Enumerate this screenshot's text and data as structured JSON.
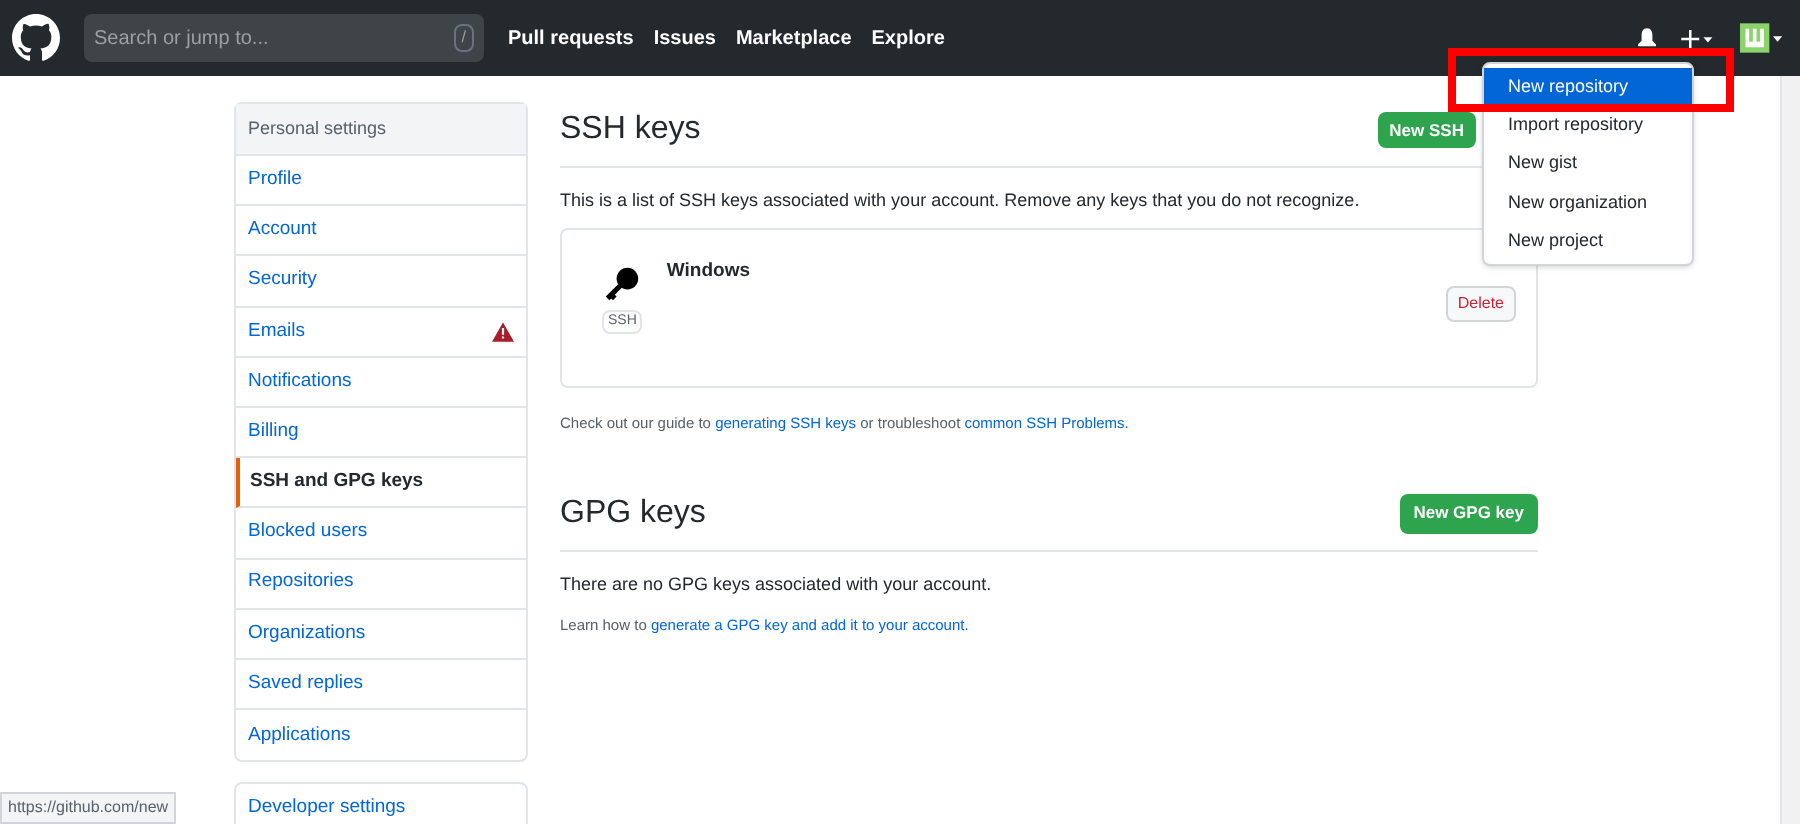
{
  "header": {
    "search_placeholder": "Search or jump to...",
    "search_key": "/",
    "nav": [
      "Pull requests",
      "Issues",
      "Marketplace",
      "Explore"
    ]
  },
  "sidebar": {
    "title": "Personal settings",
    "items": [
      {
        "label": "Profile",
        "selected": false,
        "warning": false
      },
      {
        "label": "Account",
        "selected": false,
        "warning": false
      },
      {
        "label": "Security",
        "selected": false,
        "warning": false
      },
      {
        "label": "Emails",
        "selected": false,
        "warning": true
      },
      {
        "label": "Notifications",
        "selected": false,
        "warning": false
      },
      {
        "label": "Billing",
        "selected": false,
        "warning": false
      },
      {
        "label": "SSH and GPG keys",
        "selected": true,
        "warning": false
      },
      {
        "label": "Blocked users",
        "selected": false,
        "warning": false
      },
      {
        "label": "Repositories",
        "selected": false,
        "warning": false
      },
      {
        "label": "Organizations",
        "selected": false,
        "warning": false
      },
      {
        "label": "Saved replies",
        "selected": false,
        "warning": false
      },
      {
        "label": "Applications",
        "selected": false,
        "warning": false
      }
    ],
    "developer": "Developer settings"
  },
  "ssh": {
    "title": "SSH keys",
    "button": "New SSH",
    "description": "This is a list of SSH keys associated with your account. Remove any keys that you do not recognize.",
    "keys": [
      {
        "name": "Windows",
        "badge": "SSH",
        "action": "Delete"
      }
    ],
    "help_prefix": "Check out our guide to",
    "help_link1": "generating SSH keys",
    "help_middle": "or troubleshoot",
    "help_link2": "common SSH Problems."
  },
  "gpg": {
    "title": "GPG keys",
    "button": "New GPG key",
    "description": "There are no GPG keys associated with your account.",
    "help_prefix": "Learn how to",
    "help_link": "generate a GPG key and add it to your account."
  },
  "menu": {
    "items": [
      {
        "label": "New repository",
        "selected": true
      },
      {
        "label": "Import repository",
        "selected": false
      },
      {
        "label": "New gist",
        "selected": false
      },
      {
        "label": "New organization",
        "selected": false
      },
      {
        "label": "New project",
        "selected": false
      }
    ]
  },
  "status_url": "https://github.com/new"
}
